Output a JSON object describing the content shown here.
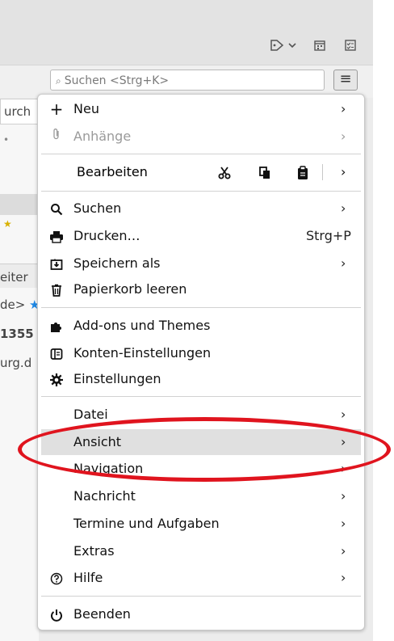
{
  "toolbar": {
    "icons": [
      "tag-icon",
      "chevron-down-icon",
      "calendar-icon",
      "tasks-icon"
    ],
    "search_placeholder": "Suchen <Strg+K>",
    "menu_icon": "hamburger-menu-icon"
  },
  "left_fragments": {
    "search_frag": "urch",
    "frag_dot": "•",
    "frag1": "eiter",
    "frag2": "de>",
    "frag3": "1355",
    "frag4": "urg.d"
  },
  "menu": {
    "items": [
      {
        "label": "Neu",
        "icon": "+",
        "submenu": true
      },
      {
        "label": "Anhänge",
        "icon": "paperclip",
        "submenu": true,
        "disabled": true
      },
      {
        "label": "Bearbeiten"
      },
      {
        "label": "Suchen",
        "icon": "search",
        "submenu": true
      },
      {
        "label": "Drucken…",
        "icon": "printer",
        "accelerator": "Strg+P"
      },
      {
        "label": "Speichern als",
        "icon": "save",
        "submenu": true
      },
      {
        "label": "Papierkorb leeren",
        "icon": "trash"
      },
      {
        "label": "Add-ons und Themes",
        "icon": "puzzle"
      },
      {
        "label": "Konten-Einstellungen",
        "icon": "account-settings"
      },
      {
        "label": "Einstellungen",
        "icon": "gear"
      },
      {
        "label": "Datei",
        "submenu": true
      },
      {
        "label": "Ansicht",
        "submenu": true,
        "highlighted": true
      },
      {
        "label": "Navigation",
        "submenu": true
      },
      {
        "label": "Nachricht",
        "submenu": true
      },
      {
        "label": "Termine und Aufgaben",
        "submenu": true
      },
      {
        "label": "Extras",
        "submenu": true
      },
      {
        "label": "Hilfe",
        "icon": "help",
        "submenu": true
      },
      {
        "label": "Beenden",
        "icon": "power"
      }
    ],
    "edit_icons": [
      "cut-icon",
      "copy-icon",
      "paste-icon"
    ],
    "arrow_glyph": "›"
  },
  "colors": {
    "highlight": "#e0e0e0",
    "annotation_red": "#e0141e",
    "blue_star": "#1e88e5"
  }
}
